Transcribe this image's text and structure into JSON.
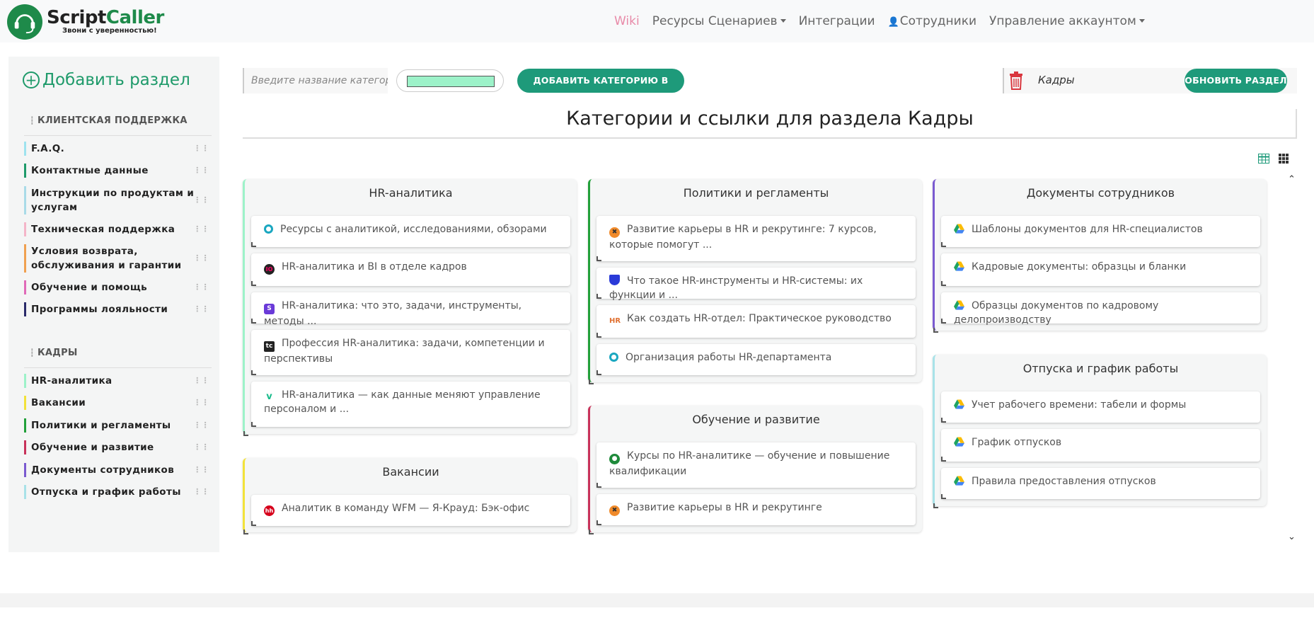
{
  "brand": {
    "name_a": "Script",
    "name_b": "Caller",
    "tagline": "Звони с уверенностью!"
  },
  "nav": {
    "wiki": "Wiki",
    "scripts": "Ресурсы Сценариев",
    "integrations": "Интеграции",
    "employees": "Сотрудники",
    "account": "Управление аккаунтом"
  },
  "sidebar": {
    "add_section": "Добавить раздел",
    "groups": [
      {
        "title": "КЛИЕНТСКАЯ ПОДДЕРЖКА",
        "items": [
          "F.A.Q.",
          "Контактные данные",
          "Инструкции по продуктам и услугам",
          "Техническая поддержка",
          "Условия возврата, обслуживания и гарантии",
          "Обучение и помощь",
          "Программы лояльности"
        ]
      },
      {
        "title": "КАДРЫ",
        "items": [
          "HR-аналитика",
          "Вакансии",
          "Политики и регламенты",
          "Обучение и развитие",
          "Документы сотрудников",
          "Отпуска и график работы"
        ]
      }
    ]
  },
  "toolbar": {
    "category_placeholder": "Введите название категории",
    "add_category_button": "ДОБАВИТЬ КАТЕГОРИЮ В РАЗДЕЛ",
    "color_value": "#9df2c9",
    "section_name": "Кадры",
    "update_button": "ОБНОВИТЬ РАЗДЕЛ"
  },
  "page_title": "Категории и ссылки для раздела Кадры",
  "cards": [
    {
      "title": "HR-аналитика",
      "links": [
        {
          "text": "Ресурсы с аналитикой, исследованиями, обзорами",
          "icon": "circle-teal-icon"
        },
        {
          "text": "HR-аналитика и BI в отделе кадров",
          "icon": "io-icon"
        },
        {
          "text": "HR-аналитика: что это, задачи, инструменты, методы ...",
          "icon": "s-icon"
        },
        {
          "text": "Профессия HR-аналитика: задачи, компетенции и перспективы",
          "icon": "tc-icon"
        },
        {
          "text": "HR-аналитика — как данные меняют управление персоналом и ...",
          "icon": "v-icon"
        }
      ]
    },
    {
      "title": "Вакансии",
      "links": [
        {
          "text": "Аналитик в команду WFM — Я-Крауд: Бэк-офис",
          "icon": "hh-icon"
        }
      ]
    },
    {
      "title": "Политики и регламенты",
      "links": [
        {
          "text": "Развитие карьеры в HR и рекрутинге: 7 курсов, которые помогут ...",
          "icon": "orange-x-icon"
        },
        {
          "text": "Что такое HR-инструменты и HR-системы: их функции и ...",
          "icon": "blue-shield-icon"
        },
        {
          "text": "Как создать HR-отдел: Практическое руководство",
          "icon": "hr-icon"
        },
        {
          "text": "Организация работы HR-департамента",
          "icon": "circle-teal-icon"
        }
      ]
    },
    {
      "title": "Обучение и развитие",
      "links": [
        {
          "text": "Курсы по HR-аналитике — обучение и повышение квалификации",
          "icon": "green-circle-icon"
        },
        {
          "text": "Развитие карьеры в HR и рекрутинге",
          "icon": "orange-x-icon"
        }
      ]
    },
    {
      "title": "Документы сотрудников",
      "links": [
        {
          "text": "Шаблоны документов для HR-специалистов",
          "icon": "google-drive-icon"
        },
        {
          "text": "Кадровые документы: образцы и бланки",
          "icon": "google-drive-icon"
        },
        {
          "text": "Образцы документов по кадровому делопроизводству",
          "icon": "google-drive-icon"
        }
      ]
    },
    {
      "title": "Отпуска и график работы",
      "links": [
        {
          "text": "Учет рабочего времени: табели и формы",
          "icon": "google-drive-icon"
        },
        {
          "text": "График отпусков",
          "icon": "google-drive-icon"
        },
        {
          "text": "Правила предоставления отпусков",
          "icon": "google-drive-icon"
        }
      ]
    }
  ],
  "icon_glyphs": {
    "io": "IO",
    "s": "S",
    "tc": "tc",
    "v": "v",
    "hh": "hh",
    "hr": "HR"
  },
  "colors": {
    "accent": "#1e9a7a",
    "wiki": "#e88aa8",
    "danger": "#d9363e"
  }
}
